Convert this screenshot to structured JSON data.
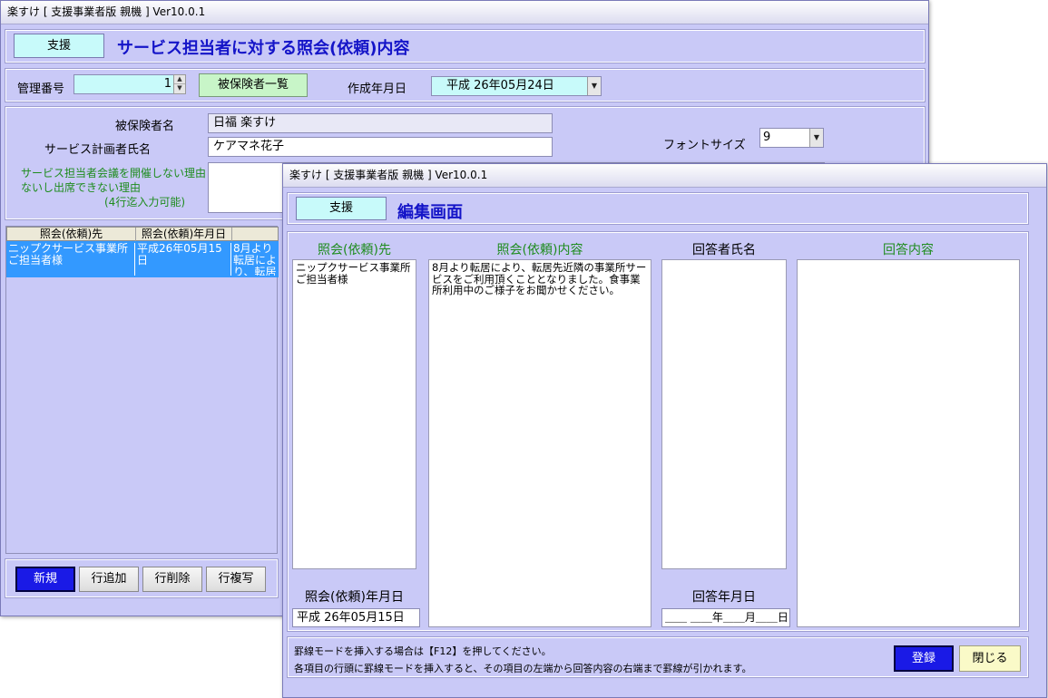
{
  "back_window": {
    "title": "楽すけ [ 支援事業者版 親機 ] Ver10.0.1",
    "mode_tag": "支援",
    "heading": "サービス担当者に対する照会(依頼)内容",
    "mgmt_label": "管理番号",
    "mgmt_value": "1",
    "insured_list_button": "被保険者一覧",
    "created_label": "作成年月日",
    "created_value": "平成  26年05月24日",
    "insured_name_label": "被保険者名",
    "insured_name_value": "日福  楽すけ",
    "planner_label": "サービス計画者氏名",
    "planner_value": "ケアマネ花子",
    "font_size_label": "フォントサイズ",
    "font_size_value": "9",
    "reason_label_1": "サービス担当者会議を開催しない理由",
    "reason_label_2": "ないし出席できない理由",
    "reason_label_3": "(4行迄入力可能)",
    "grid_headers": [
      "照会(依頼)先",
      "照会(依頼)年月日",
      ""
    ],
    "grid_rows": [
      {
        "target": "ニップクサービス事業所ご担当者様",
        "date": "平成26年05月15日",
        "content": "8月より転居により、転居先近隣の事業所サービスをご利用頂くこととなりました。食事業所利用中のご様子をお聞かせください。"
      }
    ],
    "buttons": {
      "new": "新規",
      "add_row": "行追加",
      "delete_row": "行削除",
      "copy_row": "行複写"
    }
  },
  "front_window": {
    "title": "楽すけ [ 支援事業者版 親機 ] Ver10.0.1",
    "mode_tag": "支援",
    "heading": "編集画面",
    "col_target": "照会(依頼)先",
    "col_content": "照会(依頼)内容",
    "col_responder": "回答者氏名",
    "col_answer": "回答内容",
    "target_text": "ニップクサービス事業所ご担当者様",
    "content_text": "8月より転居により、転居先近隣の事業所サービスをご利用頂くこととなりました。食事業所利用中のご様子をお聞かせください。",
    "responder_text": "",
    "answer_text": "",
    "request_date_label": "照会(依頼)年月日",
    "request_date_value": "平成  26年05月15日",
    "answer_date_label": "回答年月日",
    "answer_date_value": "＿＿  ＿＿年＿＿月＿＿日",
    "note_1": "罫線モードを挿入する場合は【F12】を押してください。",
    "note_2": "各項目の行頭に罫線モードを挿入すると、その項目の左端から回答内容の右端まで罫線が引かれます。",
    "register_button": "登録",
    "close_button": "閉じる"
  }
}
